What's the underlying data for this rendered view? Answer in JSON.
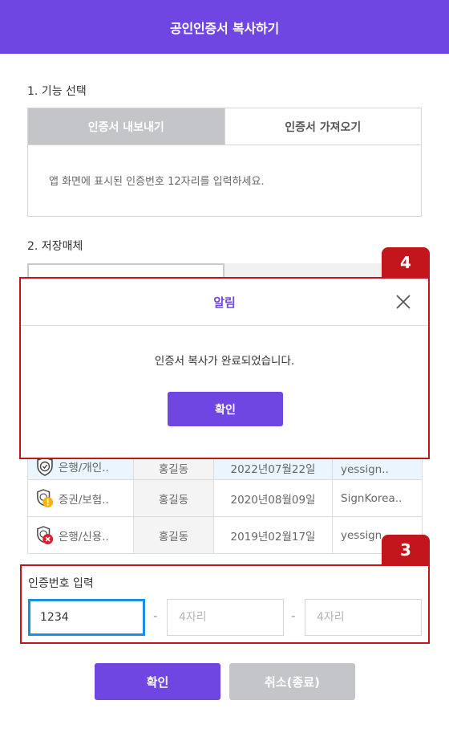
{
  "header": {
    "title": "공인인증서 복사하기"
  },
  "function_section": {
    "label": "1. 기능 선택",
    "tabs": [
      {
        "label": "인증서 내보내기",
        "active": true
      },
      {
        "label": "인증서 가져오기",
        "active": false
      }
    ],
    "instruction": "앱 화면에 표시된 인증번호 12자리를 입력하세요."
  },
  "storage_section": {
    "label": "2. 저장매체"
  },
  "cert_table": {
    "rows": [
      {
        "type": "은행/개인..",
        "name": "홍길동",
        "date": "2022년07월22일",
        "issuer": "yessign..",
        "status_icon": "shield-check-icon"
      },
      {
        "type": "증권/보험..",
        "name": "홍길동",
        "date": "2020년08월09일",
        "issuer": "SignKorea..",
        "status_icon": "shield-warning-icon"
      },
      {
        "type": "은행/신용..",
        "name": "홍길동",
        "date": "2019년02월17일",
        "issuer": "yessign..",
        "status_icon": "shield-error-icon"
      }
    ]
  },
  "auth_input": {
    "label": "인증번호 입력",
    "fields": [
      {
        "value": "1234",
        "placeholder": ""
      },
      {
        "value": "",
        "placeholder": "4자리"
      },
      {
        "value": "",
        "placeholder": "4자리"
      }
    ],
    "separator": "-"
  },
  "badges": {
    "modal": "4",
    "input": "3"
  },
  "buttons": {
    "confirm": "확인",
    "cancel": "취소(종료)"
  },
  "modal": {
    "title": "알림",
    "message": "인증서 복사가 완료되었습니다.",
    "ok_label": "확인"
  },
  "colors": {
    "brand": "#6f46e2",
    "highlight": "#c3161c",
    "focus": "#1a8fe3",
    "warning": "#f5b400",
    "error": "#d61f2c"
  }
}
